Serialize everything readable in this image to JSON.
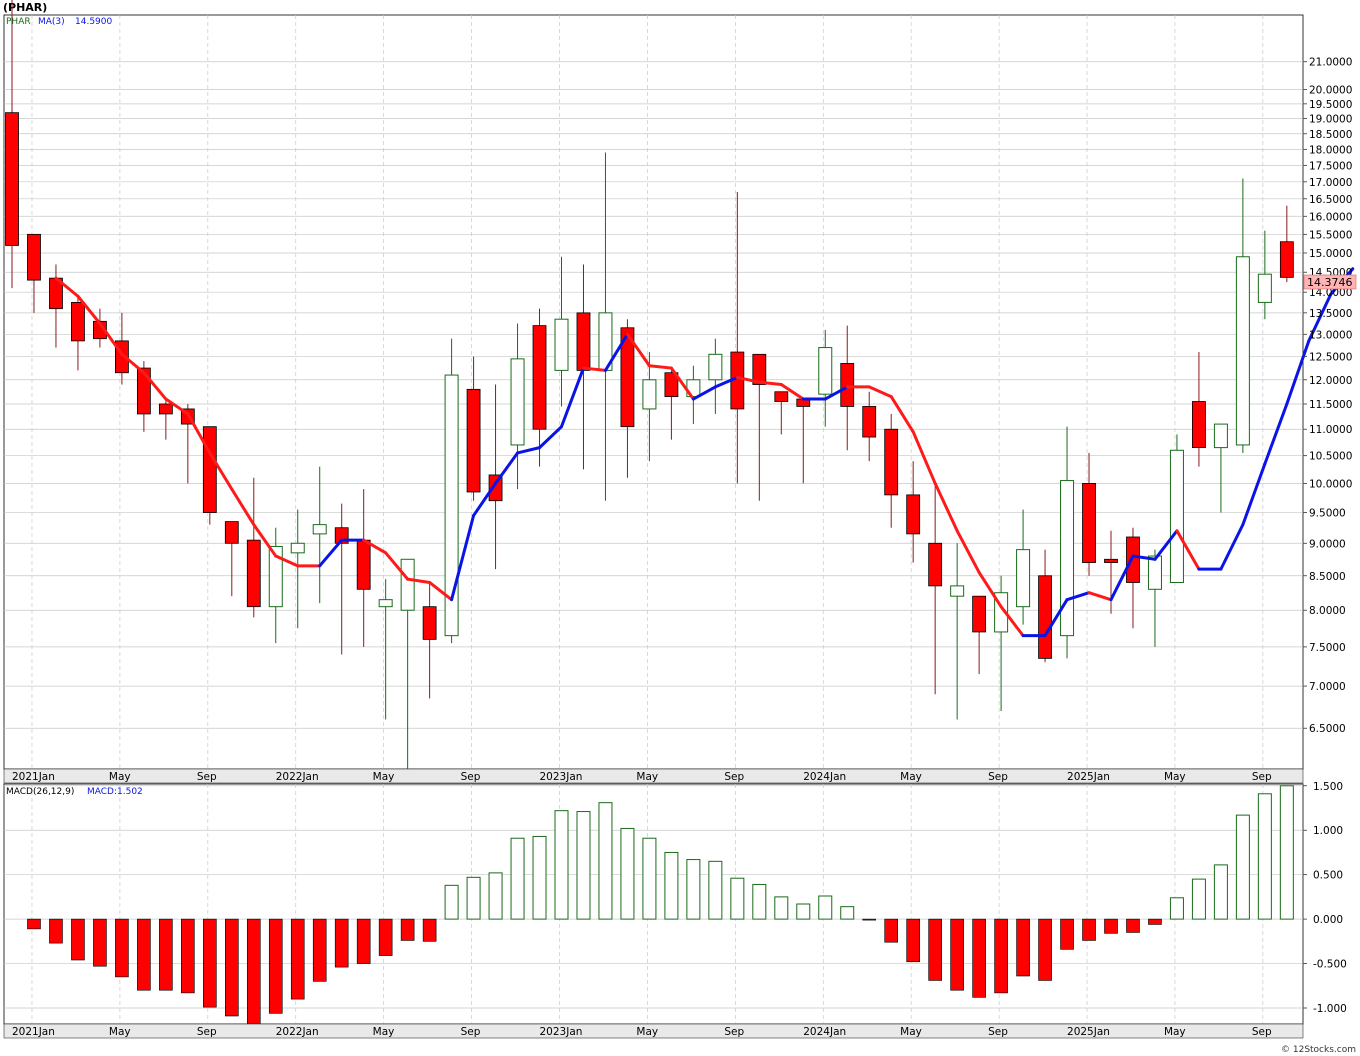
{
  "header": {
    "title": "(PHAR)",
    "legend_symbol": "PHAR",
    "legend_ma_label": "MA(3)",
    "legend_ma_value": "14.5900",
    "macd_label": "MACD(26,12,9)",
    "macd_value_label": "MACD:1.502"
  },
  "price_badge": "14.3746",
  "watermark": "© 12Stocks.com",
  "colors": {
    "up": "#1a6b1a",
    "down": "#ff0000",
    "ma_up": "#0a14e6",
    "ma_down": "#ff1a1a",
    "grid": "#c8c8c8",
    "macd_pos": "#1a6b1a",
    "macd_neg": "#ff0000"
  },
  "chart_data": [
    {
      "type": "candlestick",
      "title": "(PHAR)",
      "interval": "monthly",
      "x_labels": [
        "2021Jan",
        "May",
        "Sep",
        "2022Jan",
        "May",
        "Sep",
        "2023Jan",
        "May",
        "Sep",
        "2024Jan",
        "May",
        "Sep",
        "2025Jan",
        "May",
        "Sep"
      ],
      "y_ticks": [
        6.5,
        7.0,
        7.5,
        8.0,
        8.5,
        9.0,
        9.5,
        10.0,
        10.5,
        11.0,
        11.5,
        12.0,
        12.5,
        13.0,
        13.5,
        14.0,
        14.5,
        15.0,
        15.5,
        16.0,
        16.5,
        17.0,
        17.5,
        18.0,
        18.5,
        19.0,
        19.5,
        20.0,
        21.0
      ],
      "y_tick_labels": [
        "6.5000",
        "7.0000",
        "7.5000",
        "8.0000",
        "8.5000",
        "9.0000",
        "9.5000",
        "10.0000",
        "10.5000",
        "11.0000",
        "11.5000",
        "12.0000",
        "12.5000",
        "13.0000",
        "13.5000",
        "14.0000",
        "14.5000",
        "15.0000",
        "15.5000",
        "16.0000",
        "16.5000",
        "17.0000",
        "17.5000",
        "18.0000",
        "18.5000",
        "19.0000",
        "19.5000",
        "20.0000",
        "21.0000"
      ],
      "ylim": [
        6.05,
        22.8
      ],
      "scale": "log",
      "candles": [
        {
          "date": "2020-12",
          "open": 19.2,
          "high": 23.5,
          "low": 14.1,
          "close": 15.2
        },
        {
          "date": "2021-01",
          "open": 15.5,
          "high": 15.5,
          "low": 13.5,
          "close": 14.3
        },
        {
          "date": "2021-02",
          "open": 14.35,
          "high": 14.7,
          "low": 12.7,
          "close": 13.6
        },
        {
          "date": "2021-03",
          "open": 13.75,
          "high": 13.9,
          "low": 12.2,
          "close": 12.85
        },
        {
          "date": "2021-04",
          "open": 13.3,
          "high": 13.6,
          "low": 12.7,
          "close": 12.9
        },
        {
          "date": "2021-05",
          "open": 12.85,
          "high": 13.5,
          "low": 11.9,
          "close": 12.15
        },
        {
          "date": "2021-06",
          "open": 12.25,
          "high": 12.4,
          "low": 10.95,
          "close": 11.3
        },
        {
          "date": "2021-07",
          "open": 11.5,
          "high": 11.6,
          "low": 10.8,
          "close": 11.3
        },
        {
          "date": "2021-08",
          "open": 11.4,
          "high": 11.5,
          "low": 10.0,
          "close": 11.1
        },
        {
          "date": "2021-09",
          "open": 11.05,
          "high": 11.05,
          "low": 9.3,
          "close": 9.5
        },
        {
          "date": "2021-10",
          "open": 9.35,
          "high": 9.35,
          "low": 8.2,
          "close": 9.0
        },
        {
          "date": "2021-11",
          "open": 9.05,
          "high": 10.1,
          "low": 7.9,
          "close": 8.05
        },
        {
          "date": "2021-12",
          "open": 8.05,
          "high": 9.25,
          "low": 7.55,
          "close": 8.95
        },
        {
          "date": "2022-01",
          "open": 8.85,
          "high": 9.55,
          "low": 7.75,
          "close": 9.0
        },
        {
          "date": "2022-02",
          "open": 9.15,
          "high": 10.3,
          "low": 8.1,
          "close": 9.3
        },
        {
          "date": "2022-03",
          "open": 9.25,
          "high": 9.65,
          "low": 7.4,
          "close": 9.0
        },
        {
          "date": "2022-04",
          "open": 9.05,
          "high": 9.9,
          "low": 7.5,
          "close": 8.3
        },
        {
          "date": "2022-05",
          "open": 8.05,
          "high": 8.45,
          "low": 6.6,
          "close": 8.15
        },
        {
          "date": "2022-06",
          "open": 8.0,
          "high": 8.7,
          "low": 6.05,
          "close": 8.75
        },
        {
          "date": "2022-07",
          "open": 8.05,
          "high": 8.4,
          "low": 6.85,
          "close": 7.6
        },
        {
          "date": "2022-08",
          "open": 7.65,
          "high": 12.9,
          "low": 7.55,
          "close": 12.1
        },
        {
          "date": "2022-09",
          "open": 11.8,
          "high": 12.5,
          "low": 9.7,
          "close": 9.85
        },
        {
          "date": "2022-10",
          "open": 10.15,
          "high": 11.9,
          "low": 8.6,
          "close": 9.7
        },
        {
          "date": "2022-11",
          "open": 10.7,
          "high": 13.25,
          "low": 9.9,
          "close": 12.45
        },
        {
          "date": "2022-12",
          "open": 13.2,
          "high": 13.6,
          "low": 10.3,
          "close": 11.0
        },
        {
          "date": "2023-01",
          "open": 12.2,
          "high": 14.9,
          "low": 11.45,
          "close": 13.35
        },
        {
          "date": "2023-02",
          "open": 13.5,
          "high": 14.7,
          "low": 10.25,
          "close": 12.2
        },
        {
          "date": "2023-03",
          "open": 12.2,
          "high": 17.9,
          "low": 9.7,
          "close": 13.5
        },
        {
          "date": "2023-04",
          "open": 13.15,
          "high": 13.35,
          "low": 10.1,
          "close": 11.05
        },
        {
          "date": "2023-05",
          "open": 11.4,
          "high": 12.6,
          "low": 10.4,
          "close": 12.0
        },
        {
          "date": "2023-06",
          "open": 12.15,
          "high": 12.2,
          "low": 10.8,
          "close": 11.65
        },
        {
          "date": "2023-07",
          "open": 11.65,
          "high": 12.3,
          "low": 11.1,
          "close": 12.0
        },
        {
          "date": "2023-08",
          "open": 12.0,
          "high": 12.9,
          "low": 11.3,
          "close": 12.55
        },
        {
          "date": "2023-09",
          "open": 12.6,
          "high": 16.7,
          "low": 10.0,
          "close": 11.4
        },
        {
          "date": "2023-10",
          "open": 12.55,
          "high": 12.55,
          "low": 9.7,
          "close": 11.9
        },
        {
          "date": "2023-11",
          "open": 11.75,
          "high": 11.75,
          "low": 10.9,
          "close": 11.55
        },
        {
          "date": "2023-12",
          "open": 11.6,
          "high": 11.6,
          "low": 10.0,
          "close": 11.45
        },
        {
          "date": "2024-01",
          "open": 11.7,
          "high": 13.1,
          "low": 11.05,
          "close": 12.7
        },
        {
          "date": "2024-02",
          "open": 12.35,
          "high": 13.2,
          "low": 10.6,
          "close": 11.45
        },
        {
          "date": "2024-03",
          "open": 11.45,
          "high": 11.75,
          "low": 10.4,
          "close": 10.85
        },
        {
          "date": "2024-04",
          "open": 11.0,
          "high": 11.3,
          "low": 9.25,
          "close": 9.8
        },
        {
          "date": "2024-05",
          "open": 9.8,
          "high": 10.4,
          "low": 8.7,
          "close": 9.15
        },
        {
          "date": "2024-06",
          "open": 9.0,
          "high": 10.0,
          "low": 6.9,
          "close": 8.35
        },
        {
          "date": "2024-07",
          "open": 8.2,
          "high": 9.0,
          "low": 6.6,
          "close": 8.35
        },
        {
          "date": "2024-08",
          "open": 8.2,
          "high": 8.2,
          "low": 7.15,
          "close": 7.7
        },
        {
          "date": "2024-09",
          "open": 7.7,
          "high": 8.5,
          "low": 6.7,
          "close": 8.25
        },
        {
          "date": "2024-10",
          "open": 8.05,
          "high": 9.55,
          "low": 7.8,
          "close": 8.9
        },
        {
          "date": "2024-11",
          "open": 8.5,
          "high": 8.9,
          "low": 7.3,
          "close": 7.35
        },
        {
          "date": "2024-12",
          "open": 7.65,
          "high": 11.05,
          "low": 7.35,
          "close": 10.05
        },
        {
          "date": "2025-01",
          "open": 10.0,
          "high": 10.55,
          "low": 8.5,
          "close": 8.7
        },
        {
          "date": "2025-02",
          "open": 8.75,
          "high": 9.2,
          "low": 7.95,
          "close": 8.7
        },
        {
          "date": "2025-03",
          "open": 9.1,
          "high": 9.25,
          "low": 7.75,
          "close": 8.4
        },
        {
          "date": "2025-04",
          "open": 8.3,
          "high": 8.9,
          "low": 7.5,
          "close": 8.8
        },
        {
          "date": "2025-05",
          "open": 8.4,
          "high": 10.9,
          "low": 8.4,
          "close": 10.6
        },
        {
          "date": "2025-06",
          "open": 11.55,
          "high": 12.6,
          "low": 10.3,
          "close": 10.65
        },
        {
          "date": "2025-07",
          "open": 10.65,
          "high": 11.1,
          "low": 9.5,
          "close": 11.1
        },
        {
          "date": "2025-08",
          "open": 10.7,
          "high": 17.1,
          "low": 10.55,
          "close": 14.9
        },
        {
          "date": "2025-09",
          "open": 13.75,
          "high": 15.6,
          "low": 13.35,
          "close": 14.45
        },
        {
          "date": "2025-10",
          "open": 15.3,
          "high": 16.3,
          "low": 14.25,
          "close": 14.37
        }
      ],
      "ma3": [
        null,
        null,
        14.35,
        13.9,
        13.25,
        12.55,
        12.15,
        11.6,
        11.3,
        10.55,
        9.9,
        9.3,
        8.8,
        8.65,
        8.65,
        9.05,
        9.05,
        8.85,
        8.45,
        8.4,
        8.15,
        9.45,
        10.0,
        10.55,
        10.65,
        11.05,
        12.25,
        12.2,
        13.0,
        12.3,
        12.25,
        11.6,
        11.85,
        12.05,
        11.95,
        11.9,
        11.6,
        11.6,
        11.85,
        11.85,
        11.65,
        10.95,
        10.0,
        9.2,
        8.55,
        8.05,
        7.65,
        7.65,
        8.15,
        8.25,
        8.15,
        8.8,
        8.75,
        9.2,
        8.6,
        8.6,
        9.3,
        10.35,
        11.5,
        12.85,
        13.95,
        14.59
      ],
      "ma3_direction": [
        null,
        null,
        "down",
        "down",
        "down",
        "down",
        "down",
        "down",
        "down",
        "down",
        "down",
        "down",
        "down",
        "down",
        "down",
        "up",
        "up",
        "down",
        "down",
        "down",
        "down",
        "up",
        "up",
        "up",
        "up",
        "up",
        "up",
        "down",
        "up",
        "down",
        "down",
        "down",
        "up",
        "up",
        "down",
        "down",
        "down",
        "up",
        "up",
        "down",
        "down",
        "down",
        "down",
        "down",
        "down",
        "down",
        "down",
        "up",
        "up",
        "up",
        "down",
        "up",
        "up",
        "up",
        "down",
        "up",
        "up",
        "up",
        "up",
        "up",
        "up",
        "up"
      ]
    },
    {
      "type": "bar",
      "title": "MACD(26,12,9)",
      "y_ticks": [
        -1.0,
        -0.5,
        0.0,
        0.5,
        1.0,
        1.5
      ],
      "y_tick_labels": [
        "-1.000",
        "-0.500",
        "0.000",
        "0.500",
        "1.000",
        "1.500"
      ],
      "ylim": [
        -1.18,
        1.52
      ],
      "values": [
        -0.11,
        -0.27,
        -0.46,
        -0.53,
        -0.65,
        -0.8,
        -0.8,
        -0.83,
        -0.99,
        -1.09,
        -1.18,
        -1.06,
        -0.9,
        -0.7,
        -0.54,
        -0.5,
        -0.41,
        -0.24,
        -0.25,
        0.38,
        0.47,
        0.52,
        0.91,
        0.93,
        1.22,
        1.21,
        1.31,
        1.02,
        0.91,
        0.75,
        0.67,
        0.65,
        0.46,
        0.39,
        0.25,
        0.17,
        0.26,
        0.14,
        -0.01,
        -0.26,
        -0.48,
        -0.69,
        -0.8,
        -0.88,
        -0.83,
        -0.64,
        -0.69,
        -0.34,
        -0.24,
        -0.16,
        -0.15,
        -0.06,
        0.24,
        0.45,
        0.61,
        1.17,
        1.41,
        1.5
      ]
    }
  ]
}
